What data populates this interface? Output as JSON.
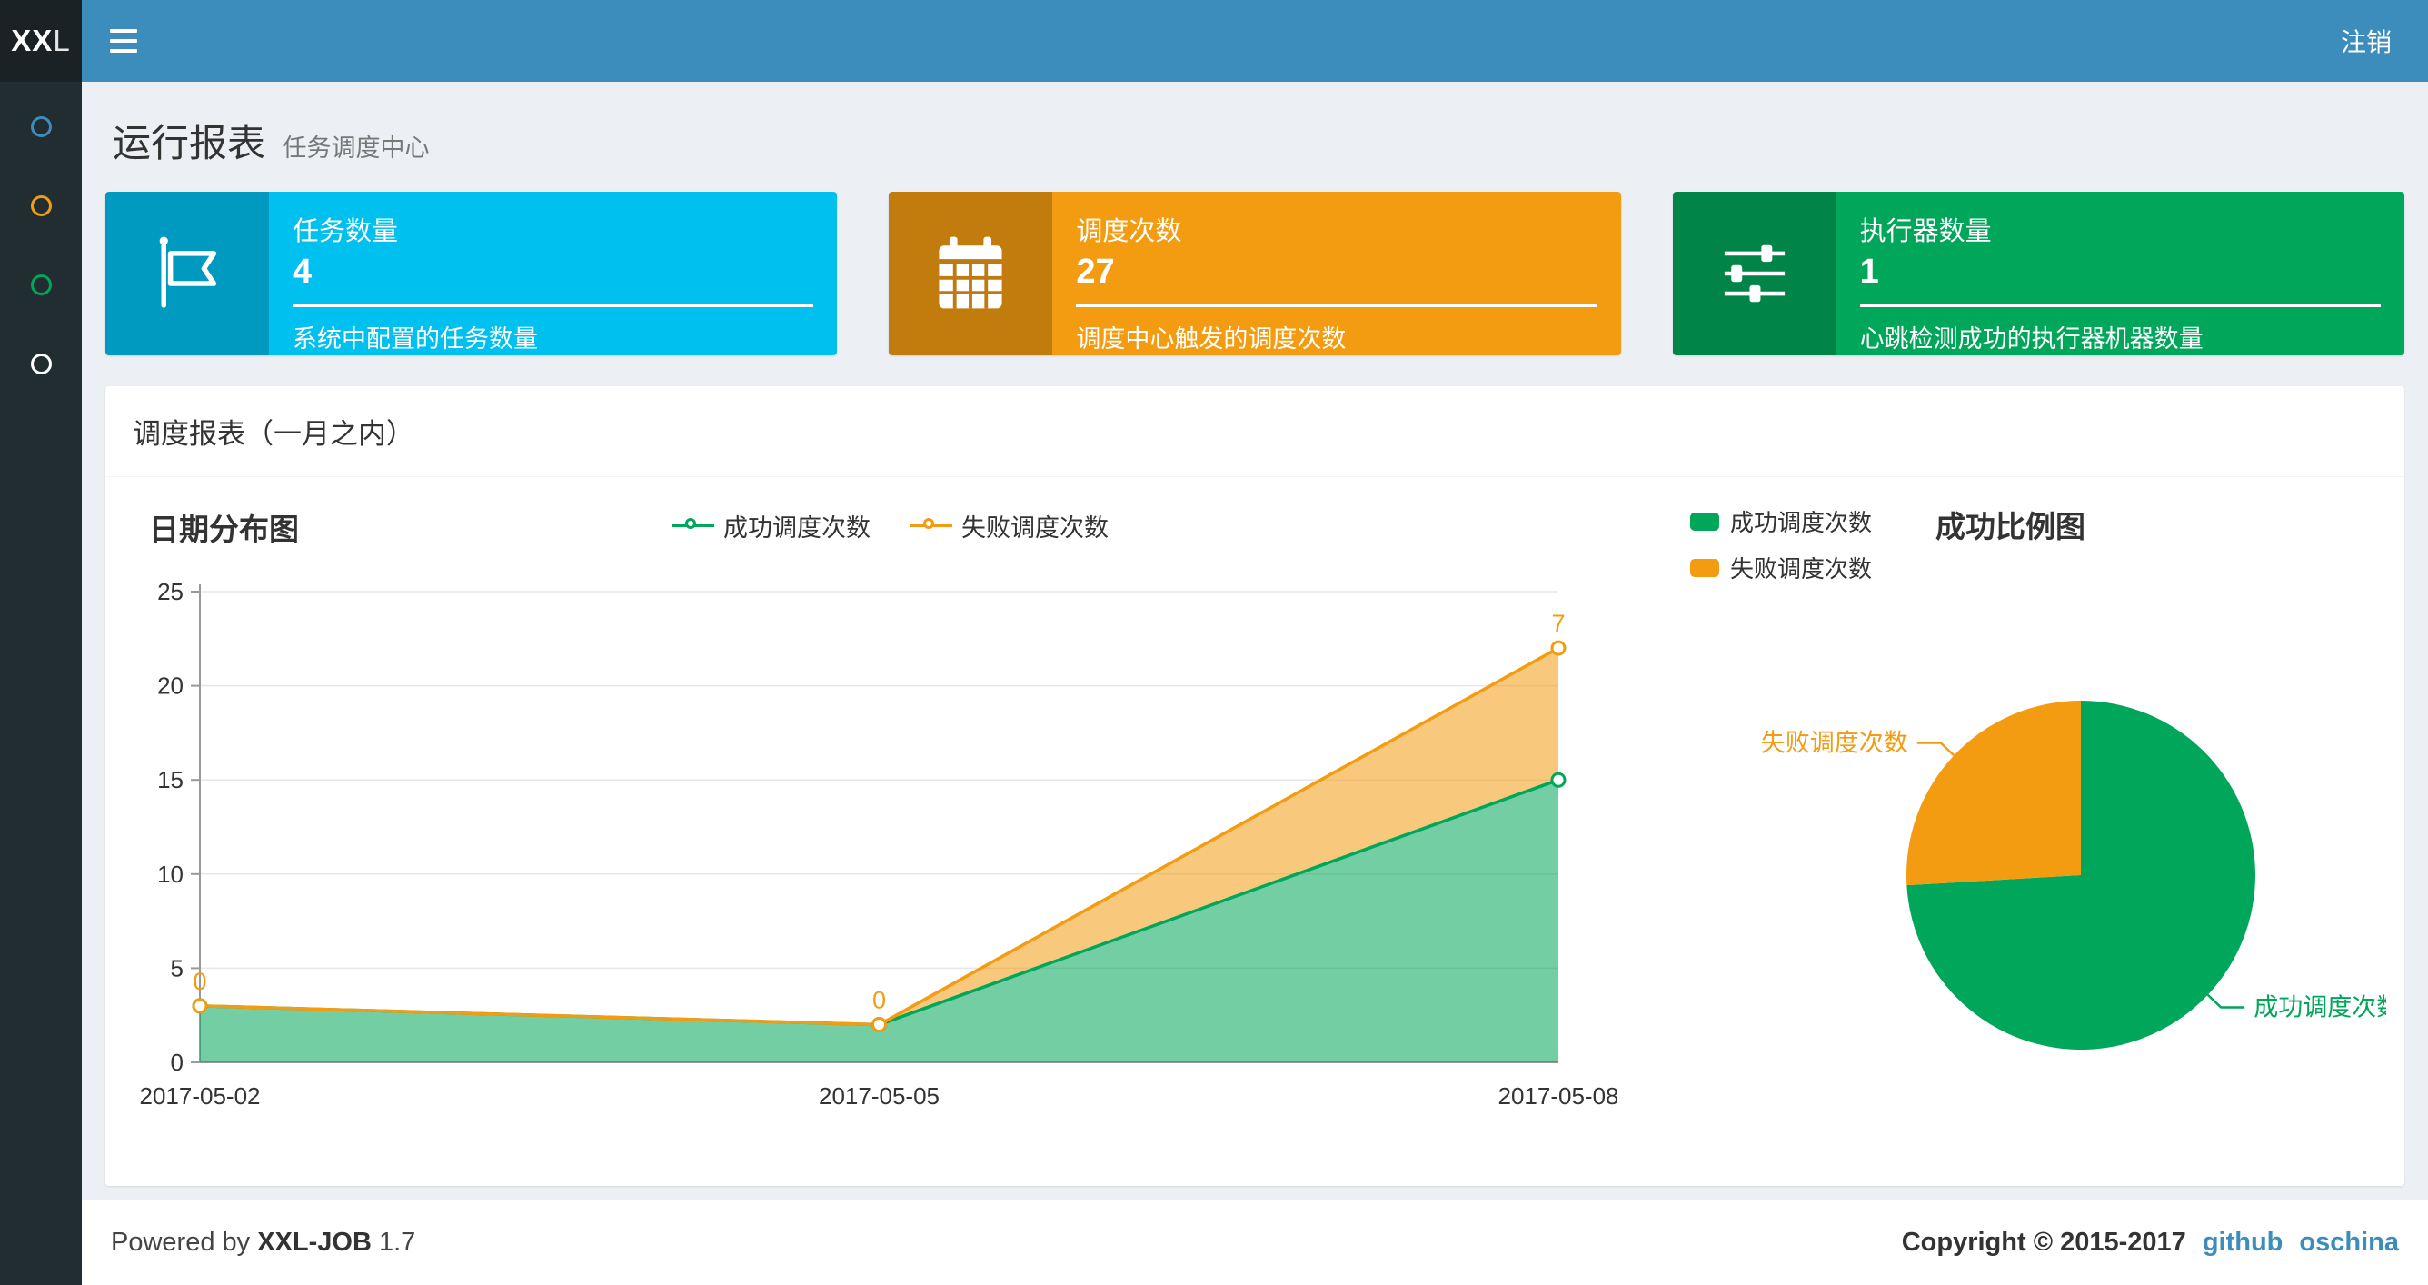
{
  "header": {
    "logo_bold": "XX",
    "logo_rest": "L",
    "logout_label": "注销"
  },
  "sidebar": {
    "items": [
      {
        "name": "menu-item-1",
        "color": "#3c8dbc",
        "active": true
      },
      {
        "name": "menu-item-2",
        "color": "#f39c12",
        "active": false
      },
      {
        "name": "menu-item-3",
        "color": "#00a65a",
        "active": false
      },
      {
        "name": "menu-item-4",
        "color": "#ffffff",
        "active": false
      }
    ]
  },
  "page": {
    "title": "运行报表",
    "subtitle": "任务调度中心"
  },
  "info_boxes": [
    {
      "label": "任务数量",
      "value": "4",
      "desc": "系统中配置的任务数量",
      "color": "#00c0ef",
      "icon": "flag-icon"
    },
    {
      "label": "调度次数",
      "value": "27",
      "desc": "调度中心触发的调度次数",
      "color": "#f39c12",
      "icon": "calendar-icon"
    },
    {
      "label": "执行器数量",
      "value": "1",
      "desc": "心跳检测成功的执行器机器数量",
      "color": "#00a65a",
      "icon": "sliders-icon"
    }
  ],
  "panel": {
    "title": "调度报表（一月之内）"
  },
  "chart_data": [
    {
      "type": "area",
      "title": "日期分布图",
      "x": [
        "2017-05-02",
        "2017-05-05",
        "2017-05-08"
      ],
      "series": [
        {
          "name": "成功调度次数",
          "color": "#00a65a",
          "values": [
            3,
            2,
            15
          ]
        },
        {
          "name": "失败调度次数",
          "color": "#f39c12",
          "values": [
            0,
            0,
            7
          ],
          "point_labels": [
            "0",
            "0",
            "7"
          ]
        }
      ],
      "stacked": true,
      "ylim": [
        0,
        25
      ],
      "yticks": [
        0,
        5,
        10,
        15,
        20,
        25
      ],
      "xlabel": "",
      "ylabel": "",
      "grid": true,
      "legend_position": "top-center"
    },
    {
      "type": "pie",
      "title": "成功比例图",
      "slices": [
        {
          "name": "成功调度次数",
          "value": 20,
          "color": "#00a65a"
        },
        {
          "name": "失败调度次数",
          "value": 7,
          "color": "#f39c12"
        }
      ],
      "legend_position": "top-left"
    }
  ],
  "footer": {
    "powered_prefix": "Powered by",
    "brand": "XXL-JOB",
    "version": "1.7",
    "copyright": "Copyright © 2015-2017",
    "links": [
      {
        "label": "github"
      },
      {
        "label": "oschina"
      }
    ]
  }
}
